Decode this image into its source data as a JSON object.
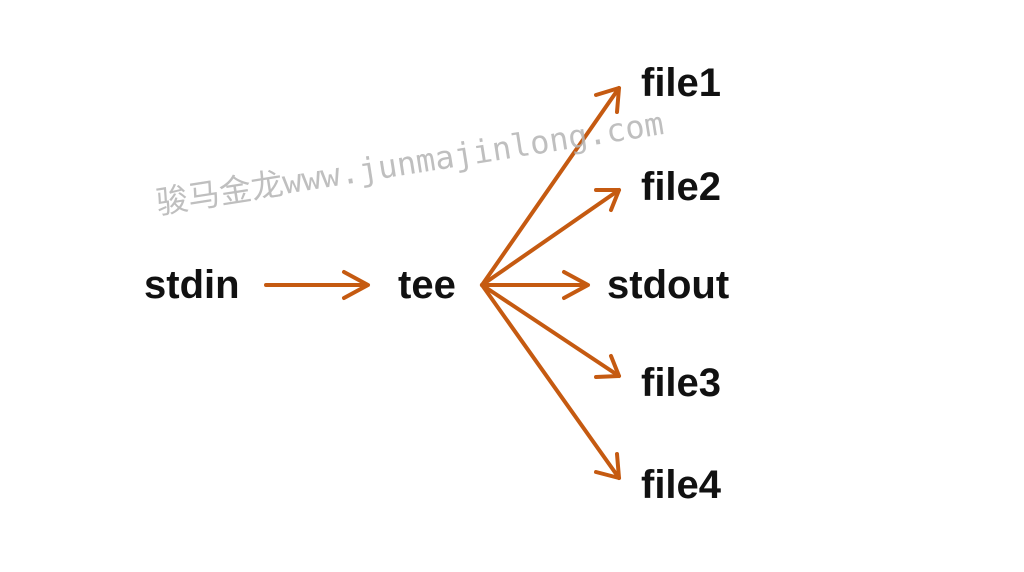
{
  "diagram": {
    "nodes": {
      "stdin": "stdin",
      "tee": "tee",
      "stdout": "stdout",
      "file1": "file1",
      "file2": "file2",
      "file3": "file3",
      "file4": "file4"
    },
    "watermark": "骏马金龙www.junmajinlong.com",
    "colors": {
      "arrow": "#c55a11",
      "text": "#111111",
      "watermark": "#b5b5b5"
    }
  }
}
